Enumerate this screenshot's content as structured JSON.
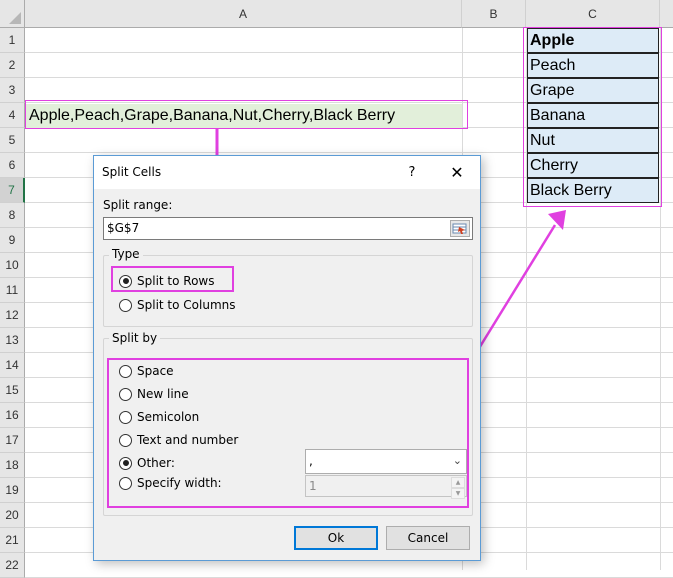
{
  "spreadsheet": {
    "columns": [
      "A",
      "B",
      "C"
    ],
    "rows": [
      "1",
      "2",
      "3",
      "4",
      "5",
      "6",
      "7",
      "8",
      "9",
      "10",
      "11",
      "12",
      "13",
      "14",
      "15",
      "16",
      "17",
      "18",
      "19",
      "20",
      "21",
      "22"
    ],
    "selected_row": "7",
    "cell_a4": "Apple,Peach,Grape,Banana,Nut,Cherry,Black Berry",
    "column_c": [
      "Apple",
      "Peach",
      "Grape",
      "Banana",
      "Nut",
      "Cherry",
      "Black Berry"
    ]
  },
  "dialog": {
    "title": "Split Cells",
    "help": "?",
    "close": "✕",
    "split_range_label": "Split range:",
    "split_range_value": "$G$7",
    "type_group": "Type",
    "type_options": [
      {
        "label": "Split to Rows",
        "selected": true
      },
      {
        "label": "Split to Columns",
        "selected": false
      }
    ],
    "split_by_group": "Split by",
    "split_by_options": [
      {
        "label": "Space",
        "selected": false
      },
      {
        "label": "New line",
        "selected": false
      },
      {
        "label": "Semicolon",
        "selected": false
      },
      {
        "label": "Text and number",
        "selected": false
      },
      {
        "label": "Other:",
        "selected": true
      },
      {
        "label": "Specify width:",
        "selected": false
      }
    ],
    "other_value": ",",
    "width_value": "1",
    "ok_label": "Ok",
    "cancel_label": "Cancel"
  },
  "annotation_color": "#e040e0"
}
